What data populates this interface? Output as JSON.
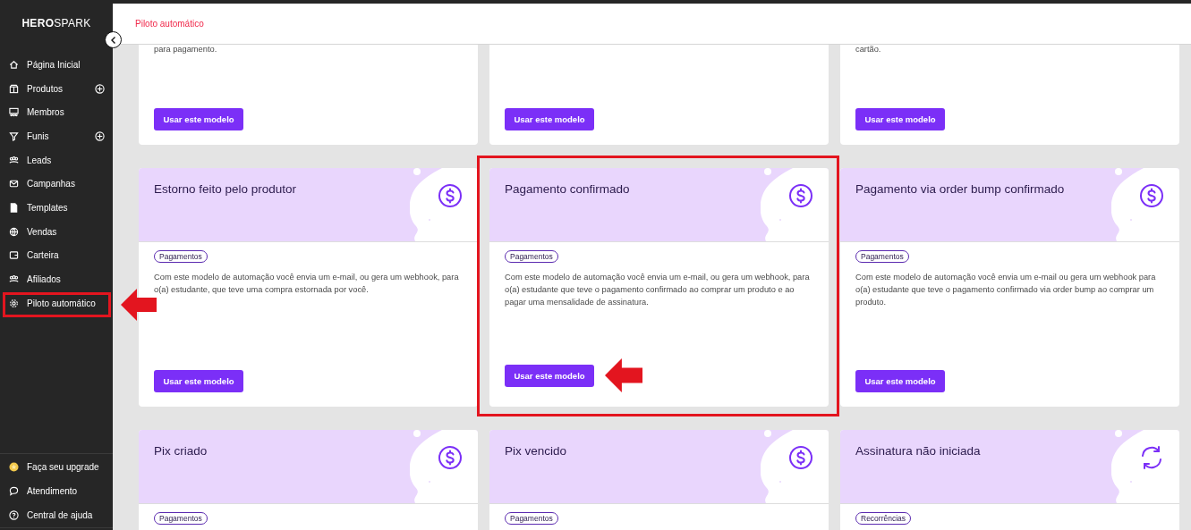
{
  "sidebar": {
    "logo": "**HERO**SPARK",
    "items": [
      {
        "label": "Página Inicial",
        "add_button": false,
        "annotated": false
      },
      {
        "label": "Produtos",
        "add_button": true,
        "annotated": false
      },
      {
        "label": "Membros",
        "add_button": false,
        "annotated": false
      },
      {
        "label": "Funis",
        "add_button": true,
        "annotated": false
      },
      {
        "label": "Leads",
        "add_button": false,
        "annotated": false
      },
      {
        "label": "Campanhas",
        "add_button": false,
        "annotated": false
      },
      {
        "label": "Templates",
        "add_button": false,
        "annotated": false
      },
      {
        "label": "Vendas",
        "add_button": false,
        "annotated": false
      },
      {
        "label": "Carteira",
        "add_button": false,
        "annotated": false
      },
      {
        "label": "Afiliados",
        "add_button": false,
        "annotated": false
      },
      {
        "label": "Piloto automático",
        "add_button": false,
        "annotated": true
      }
    ],
    "bottom_items": [
      {
        "label": "Faça seu upgrade"
      },
      {
        "label": "Atendimento"
      },
      {
        "label": "Central de ajuda"
      }
    ]
  },
  "header": {
    "title": "Piloto automático"
  },
  "cards": [
    {
      "kind": "cut",
      "description": "para pagamento.",
      "button": "Usar este modelo",
      "annotated": false
    },
    {
      "kind": "cut",
      "button": "Usar este modelo",
      "annotated": false
    },
    {
      "kind": "cut",
      "description": "cartão.",
      "button": "Usar este modelo",
      "annotated": false
    },
    {
      "kind": "full",
      "title": "Estorno feito pelo produtor",
      "tag": "Pagamentos",
      "description": "Com este modelo de automação você envia um e-mail, ou gera um webhook, para o(a) estudante, que teve uma compra estornada por você.",
      "button": "Usar este modelo",
      "annotated": false
    },
    {
      "kind": "full",
      "title": "Pagamento confirmado",
      "tag": "Pagamentos",
      "description": "Com este modelo de automação você envia um e-mail, ou gera um webhook, para o(a) estudante que teve o pagamento confirmado ao comprar um produto e ao pagar uma mensalidade de assinatura.",
      "button": "Usar este modelo",
      "annotated": true
    },
    {
      "kind": "full",
      "title": "Pagamento via order bump confirmado",
      "tag": "Pagamentos",
      "description": "Com este modelo de automação você envia um e-mail ou gera um webhook para o(a) estudante que teve o pagamento confirmado via order bump ao comprar um produto.",
      "button": "Usar este modelo",
      "annotated": false
    },
    {
      "kind": "full",
      "title": "Pix criado",
      "tag": "Pagamentos",
      "annotated": false
    },
    {
      "kind": "full",
      "title": "Pix vencido",
      "tag": "Pagamentos",
      "annotated": false
    },
    {
      "kind": "full",
      "title": "Assinatura não iniciada",
      "tag": "Recorrências",
      "annotated": false
    }
  ]
}
